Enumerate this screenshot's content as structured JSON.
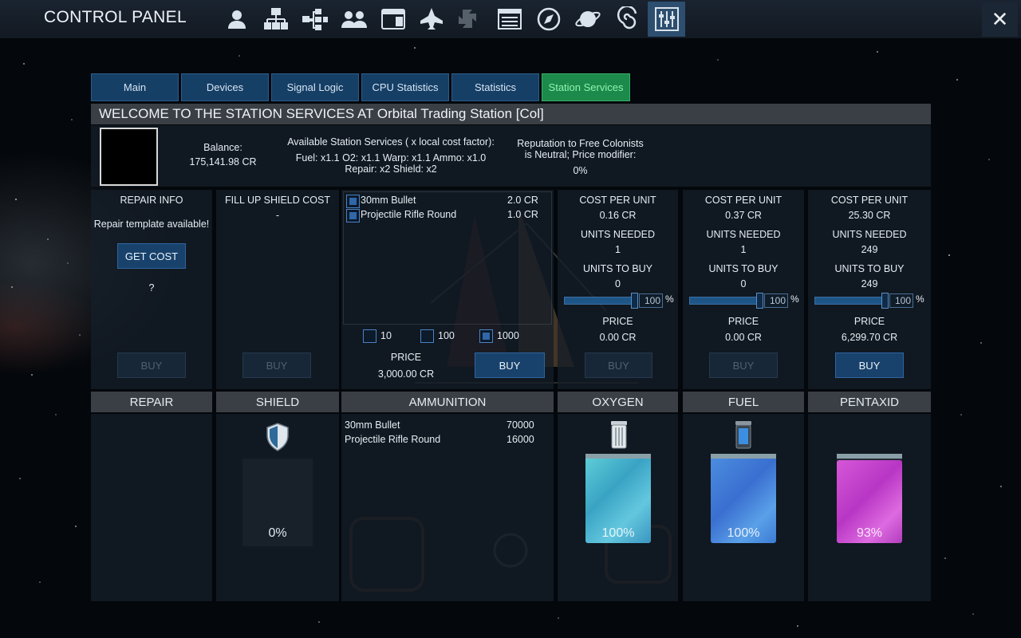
{
  "app": {
    "title": "CONTROL PANEL",
    "toolbar_icons": [
      "player-icon",
      "network-icon",
      "tree-icon",
      "crew-icon",
      "window-icon",
      "ship-icon",
      "recycle-icon",
      "list-icon",
      "compass-icon",
      "planet-icon",
      "galaxy-icon",
      "control-panel-icon"
    ],
    "active_icon": "control-panel-icon",
    "close_label": "✕"
  },
  "tabs": [
    {
      "label": "Main"
    },
    {
      "label": "Devices"
    },
    {
      "label": "Signal Logic"
    },
    {
      "label": "CPU Statistics"
    },
    {
      "label": "Statistics"
    },
    {
      "label": "Station Services",
      "active": true
    }
  ],
  "header": {
    "welcome": "WELCOME TO THE STATION SERVICES AT Orbital Trading Station [Col]",
    "balance_label": "Balance:",
    "balance_value": "175,141.98 CR",
    "services_title": "Available Station Services ( x local cost factor):",
    "services_line1": "Fuel: x1.1   O2: x1.1   Warp: x1.1   Ammo: x1.0",
    "services_line2": "Repair: x2   Shield: x2",
    "reputation_line1": "Reputation to Free Colonists",
    "reputation_line2": "is Neutral; Price modifier:",
    "reputation_value": "0%"
  },
  "repair": {
    "title": "REPAIR INFO",
    "template": "Repair template available!",
    "get_cost": "GET COST",
    "cost": "?",
    "buy": "BUY"
  },
  "shield": {
    "title": "FILL UP SHIELD COST",
    "cost": "-",
    "buy": "BUY"
  },
  "ammo_shop": {
    "items": [
      {
        "name": "30mm Bullet",
        "price": "2.0 CR"
      },
      {
        "name": "Projectile Rifle Round",
        "price": "1.0 CR"
      }
    ],
    "quantities": [
      {
        "label": "10",
        "checked": false
      },
      {
        "label": "100",
        "checked": false
      },
      {
        "label": "1000",
        "checked": true
      }
    ],
    "price_label": "PRICE",
    "price_value": "3,000.00 CR",
    "buy": "BUY"
  },
  "resources": [
    {
      "cost_label": "COST PER UNIT",
      "cost": "0.16 CR",
      "needed_label": "UNITS NEEDED",
      "needed": "1",
      "buy_label": "UNITS TO BUY",
      "to_buy": "0",
      "slider": "100",
      "pct_sign": "%",
      "price_label": "PRICE",
      "price": "0.00 CR",
      "buy": "BUY",
      "enabled": false
    },
    {
      "cost_label": "COST PER UNIT",
      "cost": "0.37 CR",
      "needed_label": "UNITS NEEDED",
      "needed": "1",
      "buy_label": "UNITS TO BUY",
      "to_buy": "0",
      "slider": "100",
      "pct_sign": "%",
      "price_label": "PRICE",
      "price": "0.00 CR",
      "buy": "BUY",
      "enabled": false
    },
    {
      "cost_label": "COST PER UNIT",
      "cost": "25.30 CR",
      "needed_label": "UNITS NEEDED",
      "needed": "249",
      "buy_label": "UNITS TO BUY",
      "to_buy": "249",
      "slider": "100",
      "pct_sign": "%",
      "price_label": "PRICE",
      "price": "6,299.70 CR",
      "buy": "BUY",
      "enabled": true
    }
  ],
  "status": {
    "repair": {
      "title": "REPAIR"
    },
    "shield": {
      "title": "SHIELD",
      "value": "0%",
      "icon": "shield-icon"
    },
    "ammunition": {
      "title": "AMMUNITION",
      "items": [
        {
          "name": "30mm Bullet",
          "count": "70000"
        },
        {
          "name": "Projectile Rifle Round",
          "count": "16000"
        }
      ]
    },
    "oxygen": {
      "title": "OXYGEN",
      "value": "100%",
      "level": 1.0,
      "color": "#49b8c9",
      "icon": "oxygen-canister-icon"
    },
    "fuel": {
      "title": "FUEL",
      "value": "100%",
      "level": 1.0,
      "color": "#3f86d6",
      "icon": "fuel-canister-icon"
    },
    "pentaxid": {
      "title": "PENTAXID",
      "value": "93%",
      "level": 0.93,
      "color": "#c43fc7"
    }
  }
}
